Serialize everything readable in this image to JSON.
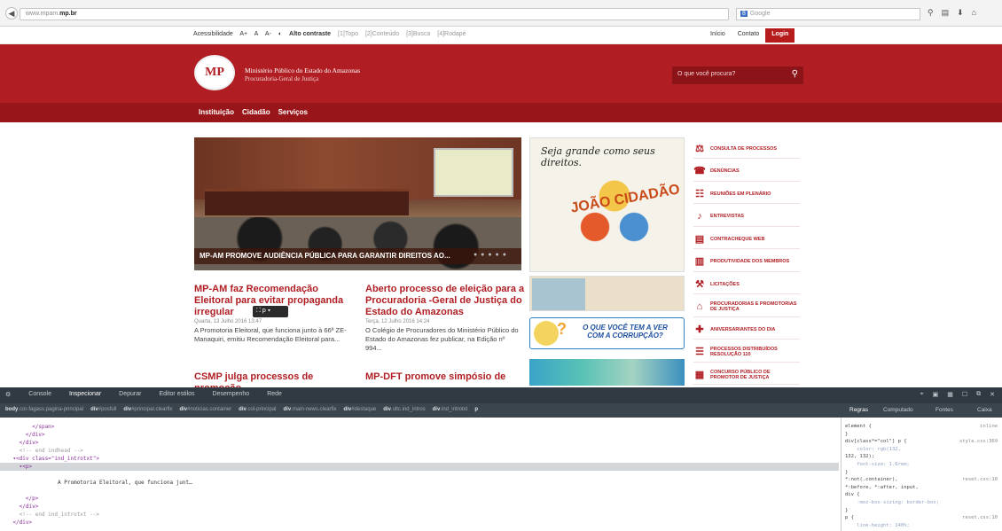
{
  "browser": {
    "url_prefix": "www.mpam.",
    "url_domain": "mp.br",
    "search_engine_badge": "8",
    "search_placeholder": "Google",
    "back_icon": "back-arrow-icon",
    "toolbar_icons": [
      "search-icon",
      "menu-icon",
      "download-icon",
      "home-icon"
    ]
  },
  "utility": {
    "items": [
      "Acessibilidade",
      "A+",
      "A",
      "A-",
      "Alto contraste",
      "[1]Topo",
      "[2]Conteúdo",
      "[3]Busca",
      "[4]Rodapé"
    ],
    "top_links": [
      "Início",
      "Contato",
      "Login"
    ]
  },
  "header": {
    "logo_text": "MP",
    "org_name": "Ministério Público do Estado do Amazonas",
    "org_sub": "Procuradoria-Geral de Justiça",
    "search_placeholder": "O que você procura?"
  },
  "mainnav": {
    "items": [
      "Instituição",
      "Cidadão",
      "Serviços"
    ]
  },
  "hero": {
    "caption": "MP-AM PROMOVE AUDIÊNCIA PÚBLICA PARA GARANTIR DIREITOS AO...",
    "dots": "● ● ● ● ●"
  },
  "news": [
    {
      "title": "MP-AM faz Recomendação Eleitoral para evitar propaganda irregular",
      "date": "Quarta, 13 Julho 2016 13:47",
      "text": "A Promotoria Eleitoral, que funciona junto à 66ª ZE- Manaquiri, emitiu Recomendação Eleitoral para..."
    },
    {
      "title": "Aberto processo de eleição para a Procuradoria -Geral de Justiça do Estado do Amazonas",
      "date": "Terça, 12 Julho 2016 14:24",
      "text": "O Colégio de Procuradores do Ministério Público do Estado do Amazonas fez publicar, na Edição nº 994..."
    },
    {
      "title": "CSMP julga processos de promoção",
      "date": "",
      "text": ""
    },
    {
      "title": "MP-DFT promove simpósio de",
      "date": "",
      "text": ""
    }
  ],
  "tooltip": {
    "text": "p"
  },
  "banners": {
    "b1_title": "Seja grande como seus direitos.",
    "b1_art": "JOÃO CIDADÃO",
    "b3_text": "O QUE VOCÊ TEM A VER COM A CORRUPÇÃO?"
  },
  "sidemenu": [
    {
      "label": "CONSULTA DE PROCESSOS",
      "icon": "gavel-icon"
    },
    {
      "label": "DENÚNCIAS",
      "icon": "megaphone-icon"
    },
    {
      "label": "REUNIÕES EM PLENÁRIO",
      "icon": "meeting-icon"
    },
    {
      "label": "ENTREVISTAS",
      "icon": "microphone-icon"
    },
    {
      "label": "CONTRACHEQUE WEB",
      "icon": "document-icon"
    },
    {
      "label": "PRODUTIVIDADE DOS MEMBROS",
      "icon": "chart-icon"
    },
    {
      "label": "LICITAÇÕES",
      "icon": "hammer-icon"
    },
    {
      "label": "PROCURADORIAS E PROMOTORIAS DE JUSTIÇA",
      "icon": "building-icon"
    },
    {
      "label": "ANIVERSARIANTES DO DIA",
      "icon": "gift-icon"
    },
    {
      "label": "PROCESSOS DISTRIBUÍDOS RESOLUÇÃO 110",
      "icon": "list-icon"
    },
    {
      "label": "CONCURSO PÚBLICO DE PROMOTOR DE JUSTIÇA",
      "icon": "clipboard-icon"
    }
  ],
  "devtools": {
    "tabs": [
      "Console",
      "Inspecionar",
      "Depurar",
      "Editor estilos",
      "Desempenho",
      "Rede"
    ],
    "active_tab": "Inspecionar",
    "breadcrumbs": [
      {
        "tag": "body",
        "cls": ".cor-fagass.pagina-principal"
      },
      {
        "tag": "div",
        "cls": "#posfull"
      },
      {
        "tag": "div",
        "cls": "#principal.clearfix"
      },
      {
        "tag": "div",
        "cls": "#noticias.container"
      },
      {
        "tag": "div",
        "cls": ".col-principal"
      },
      {
        "tag": "div",
        "cls": ".main-news.clearfix"
      },
      {
        "tag": "div",
        "cls": "#destaque"
      },
      {
        "tag": "div",
        "cls": ".ultc.ind_intros"
      },
      {
        "tag": "div",
        "cls": ".ind_introtxt"
      },
      {
        "tag": "p",
        "cls": ""
      }
    ],
    "panel_tabs": [
      "Regras",
      "Computado",
      "Fontes",
      "Caixa"
    ],
    "code_lines": [
      {
        "text": "          </span>",
        "kind": "tag"
      },
      {
        "text": "        </div>",
        "kind": "tag"
      },
      {
        "text": "      </div>",
        "kind": "tag"
      },
      {
        "text": "      <!-- end indhead -->",
        "kind": "cm"
      },
      {
        "text": "    ▾<div class=\"ind_introtxt\">",
        "kind": "tag"
      },
      {
        "text": "      ▾<p>",
        "kind": "sel"
      },
      {
        "text": "",
        "kind": "tag"
      },
      {
        "text": "                  A Promotoria Eleitoral, que funciona junt…",
        "kind": "txt"
      },
      {
        "text": "",
        "kind": "tag"
      },
      {
        "text": "        </p>",
        "kind": "tag"
      },
      {
        "text": "      </div>",
        "kind": "tag"
      },
      {
        "text": "      <!-- end ind_introtxt -->",
        "kind": "cm"
      },
      {
        "text": "    </div>",
        "kind": "tag"
      }
    ],
    "rules": [
      {
        "text": "element {",
        "src": "inline"
      },
      {
        "text": "}",
        "src": ""
      },
      {
        "text": "div[class*=\"col\"] p {",
        "src": "style.css:369"
      },
      {
        "text": "    color: rgb(132,",
        "src": ""
      },
      {
        "text": "132, 132);",
        "src": ""
      },
      {
        "text": "    font-size: 1.6rem;",
        "src": ""
      },
      {
        "text": "}",
        "src": ""
      },
      {
        "text": "*:not(.container),",
        "src": "reset.css:10"
      },
      {
        "text": "*:before, *:after, input,",
        "src": ""
      },
      {
        "text": "div {",
        "src": ""
      },
      {
        "text": "    -moz-box-sizing: border-box;",
        "src": ""
      },
      {
        "text": "}",
        "src": ""
      },
      {
        "text": "p {",
        "src": "reset.css:10"
      },
      {
        "text": "    line-height: 140%;",
        "src": ""
      }
    ]
  }
}
